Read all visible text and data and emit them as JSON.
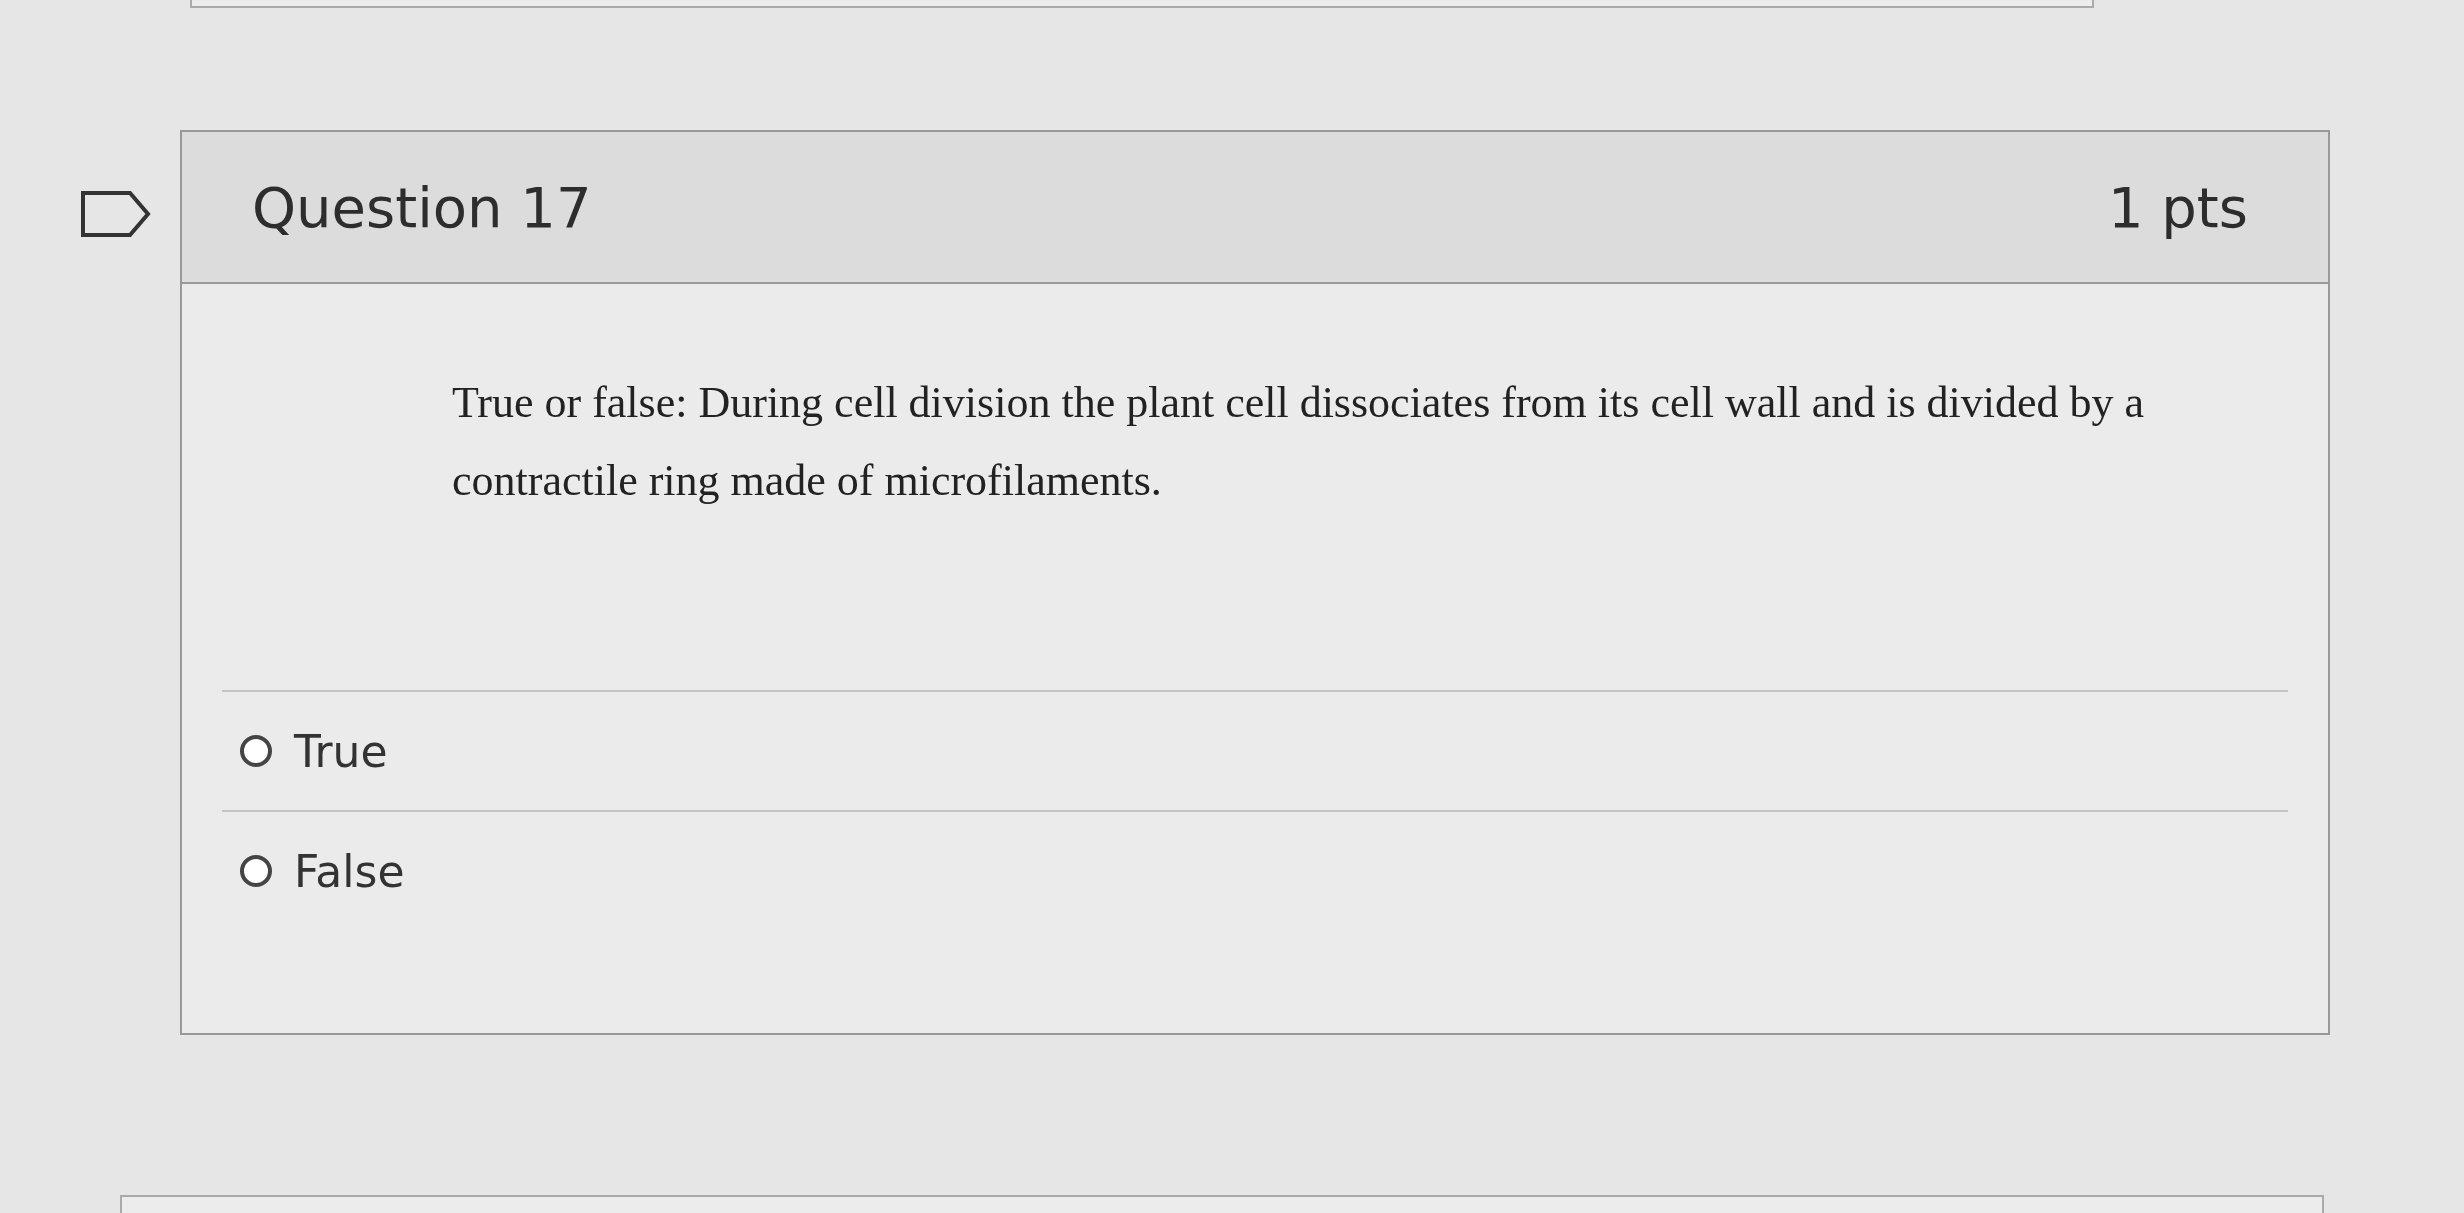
{
  "question": {
    "title": "Question 17",
    "points": "1 pts",
    "flagged": false,
    "text": "True or false: During cell division the plant cell dissociates from its cell wall and is divided by a contractile ring made of microfilaments.",
    "answers": [
      {
        "label": "True",
        "selected": false
      },
      {
        "label": "False",
        "selected": false
      }
    ]
  }
}
